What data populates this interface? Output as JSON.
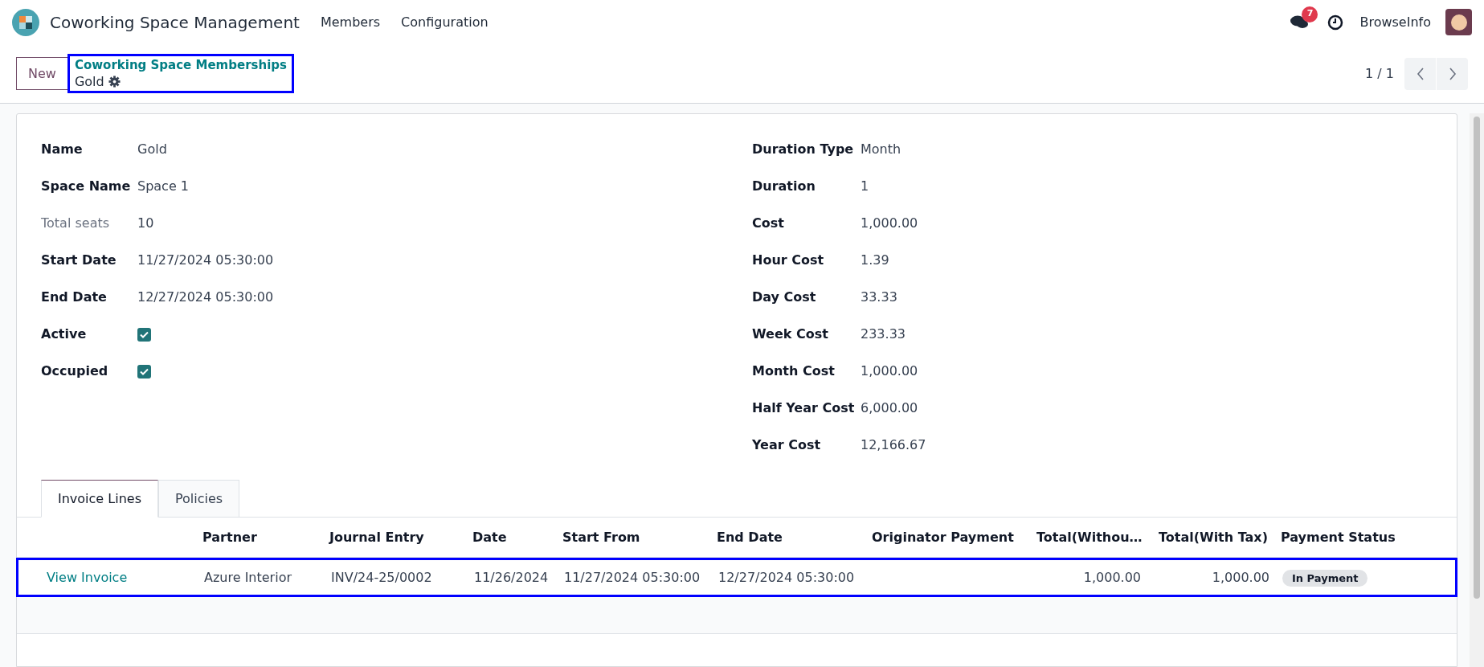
{
  "navbar": {
    "app_name": "Coworking Space Management",
    "menus": [
      "Members",
      "Configuration"
    ],
    "message_count": "7",
    "user": "BrowseInfo"
  },
  "control_panel": {
    "new_button": "New",
    "breadcrumb": "Coworking Space Memberships",
    "record": "Gold",
    "pager": "1 / 1"
  },
  "left_fields": [
    {
      "label": "Name",
      "strong": true,
      "kind": "text",
      "value": "Gold"
    },
    {
      "label": "Space Name",
      "strong": true,
      "kind": "text",
      "value": "Space 1"
    },
    {
      "label": "Total seats",
      "strong": false,
      "kind": "text",
      "value": "10"
    },
    {
      "label": "Start Date",
      "strong": true,
      "kind": "text",
      "value": "11/27/2024 05:30:00"
    },
    {
      "label": "End Date",
      "strong": true,
      "kind": "text",
      "value": "12/27/2024 05:30:00"
    },
    {
      "label": "Active",
      "strong": true,
      "kind": "checkbox",
      "checked": true
    },
    {
      "label": "Occupied",
      "strong": true,
      "kind": "checkbox",
      "checked": true
    }
  ],
  "right_fields": [
    {
      "label": "Duration Type",
      "strong": true,
      "kind": "text",
      "value": "Month"
    },
    {
      "label": "Duration",
      "strong": true,
      "kind": "text",
      "value": "1"
    },
    {
      "label": "Cost",
      "strong": true,
      "kind": "text",
      "value": "1,000.00"
    },
    {
      "label": "Hour Cost",
      "strong": true,
      "kind": "text",
      "value": "1.39"
    },
    {
      "label": "Day Cost",
      "strong": true,
      "kind": "text",
      "value": "33.33"
    },
    {
      "label": "Week Cost",
      "strong": true,
      "kind": "text",
      "value": "233.33"
    },
    {
      "label": "Month Cost",
      "strong": true,
      "kind": "text",
      "value": "1,000.00"
    },
    {
      "label": "Half Year Cost",
      "strong": true,
      "kind": "text",
      "value": "6,000.00"
    },
    {
      "label": "Year Cost",
      "strong": true,
      "kind": "text",
      "value": "12,166.67"
    }
  ],
  "tabs": [
    {
      "label": "Invoice Lines",
      "selected": true
    },
    {
      "label": "Policies",
      "selected": false
    }
  ],
  "table": {
    "columns": [
      "",
      "Partner",
      "Journal Entry",
      "Date",
      "Start From",
      "End Date",
      "Originator Payment",
      "Total(Withou…",
      "Total(With Tax)",
      "Payment Status"
    ],
    "rows": [
      {
        "cells": [
          "View Invoice",
          "Azure Interior",
          "INV/24-25/0002",
          "11/26/2024",
          "11/27/2024 05:30:00",
          "12/27/2024 05:30:00",
          "",
          "1,000.00",
          "1,000.00"
        ],
        "payment_status": "In Payment"
      }
    ]
  }
}
